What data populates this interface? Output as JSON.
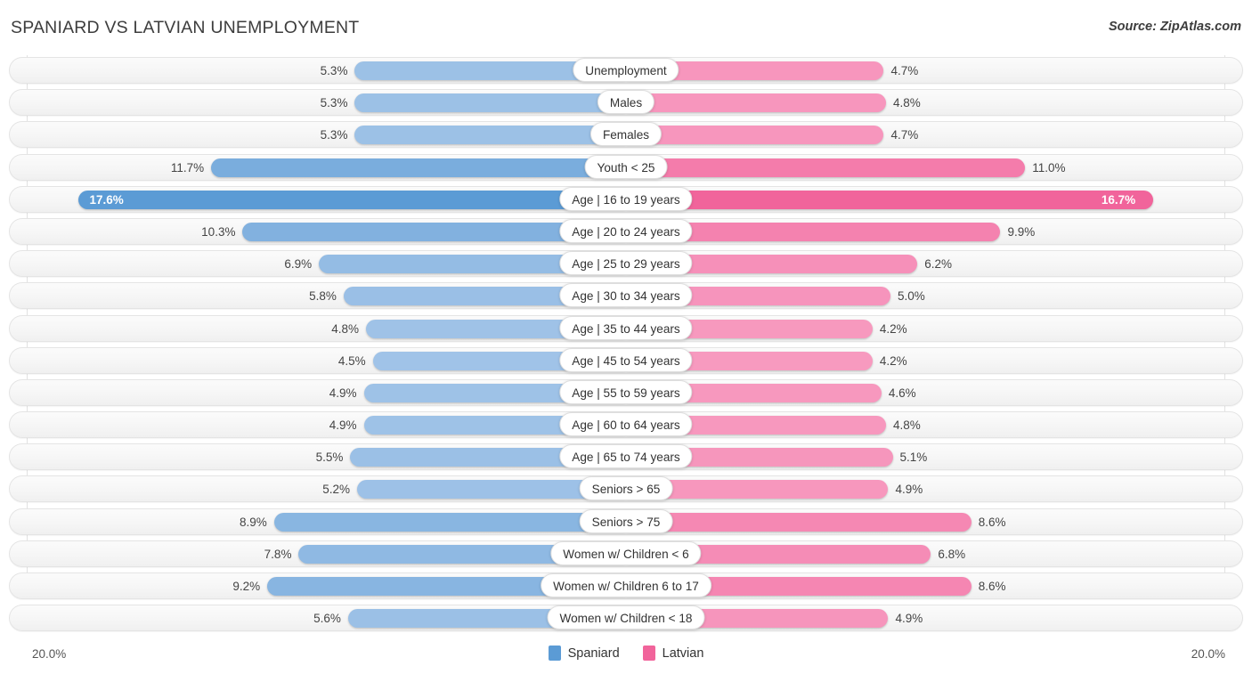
{
  "header": {
    "title": "SPANIARD VS LATVIAN UNEMPLOYMENT",
    "source": "Source: ZipAtlas.com"
  },
  "axis": {
    "left_label": "20.0%",
    "right_label": "20.0%"
  },
  "legend": {
    "items": [
      {
        "label": "Spaniard",
        "color": "#5B9BD5"
      },
      {
        "label": "Latvian",
        "color": "#F1649B"
      }
    ]
  },
  "colors": {
    "spaniard_light": "#A2C4E8",
    "spaniard_mid": "#84B3E4",
    "spaniard_strong": "#5B9BD5",
    "latvian_light": "#F79BC0",
    "latvian_mid": "#F47FAD",
    "latvian_strong": "#F1649B",
    "track": "#f4f4f4",
    "gridline": "#e2e2e2"
  },
  "chart_data": {
    "type": "bar",
    "subtype": "diverging-bidirectional",
    "title": "SPANIARD VS LATVIAN UNEMPLOYMENT",
    "xlabel": "",
    "ylabel": "",
    "xlim": [
      20.0,
      20.0
    ],
    "axis_max_percent": 20.0,
    "grid": true,
    "legend_position": "bottom-center",
    "units": "%",
    "categories": [
      "Unemployment",
      "Males",
      "Females",
      "Youth < 25",
      "Age | 16 to 19 years",
      "Age | 20 to 24 years",
      "Age | 25 to 29 years",
      "Age | 30 to 34 years",
      "Age | 35 to 44 years",
      "Age | 45 to 54 years",
      "Age | 55 to 59 years",
      "Age | 60 to 64 years",
      "Age | 65 to 74 years",
      "Seniors > 65",
      "Seniors > 75",
      "Women w/ Children < 6",
      "Women w/ Children 6 to 17",
      "Women w/ Children < 18"
    ],
    "series": [
      {
        "name": "Spaniard",
        "color": "#5B9BD5",
        "side": "left",
        "values": [
          5.3,
          5.3,
          5.3,
          11.7,
          17.6,
          10.3,
          6.9,
          5.8,
          4.8,
          4.5,
          4.9,
          4.9,
          5.5,
          5.2,
          8.9,
          7.8,
          9.2,
          5.6
        ],
        "labels": [
          "5.3%",
          "5.3%",
          "5.3%",
          "11.7%",
          "17.6%",
          "10.3%",
          "6.9%",
          "5.8%",
          "4.8%",
          "4.5%",
          "4.9%",
          "4.9%",
          "5.5%",
          "5.2%",
          "8.9%",
          "7.8%",
          "9.2%",
          "5.6%"
        ]
      },
      {
        "name": "Latvian",
        "color": "#F1649B",
        "side": "right",
        "values": [
          4.7,
          4.8,
          4.7,
          11.0,
          16.7,
          9.9,
          6.2,
          5.0,
          4.2,
          4.2,
          4.6,
          4.8,
          5.1,
          4.9,
          8.6,
          6.8,
          8.6,
          4.9
        ],
        "labels": [
          "4.7%",
          "4.8%",
          "4.7%",
          "11.0%",
          "16.7%",
          "9.9%",
          "6.2%",
          "5.0%",
          "4.2%",
          "4.2%",
          "4.6%",
          "4.8%",
          "5.1%",
          "4.9%",
          "8.6%",
          "6.8%",
          "8.6%",
          "4.9%"
        ]
      }
    ],
    "highlighted_row": "Age | 16 to 19 years"
  }
}
